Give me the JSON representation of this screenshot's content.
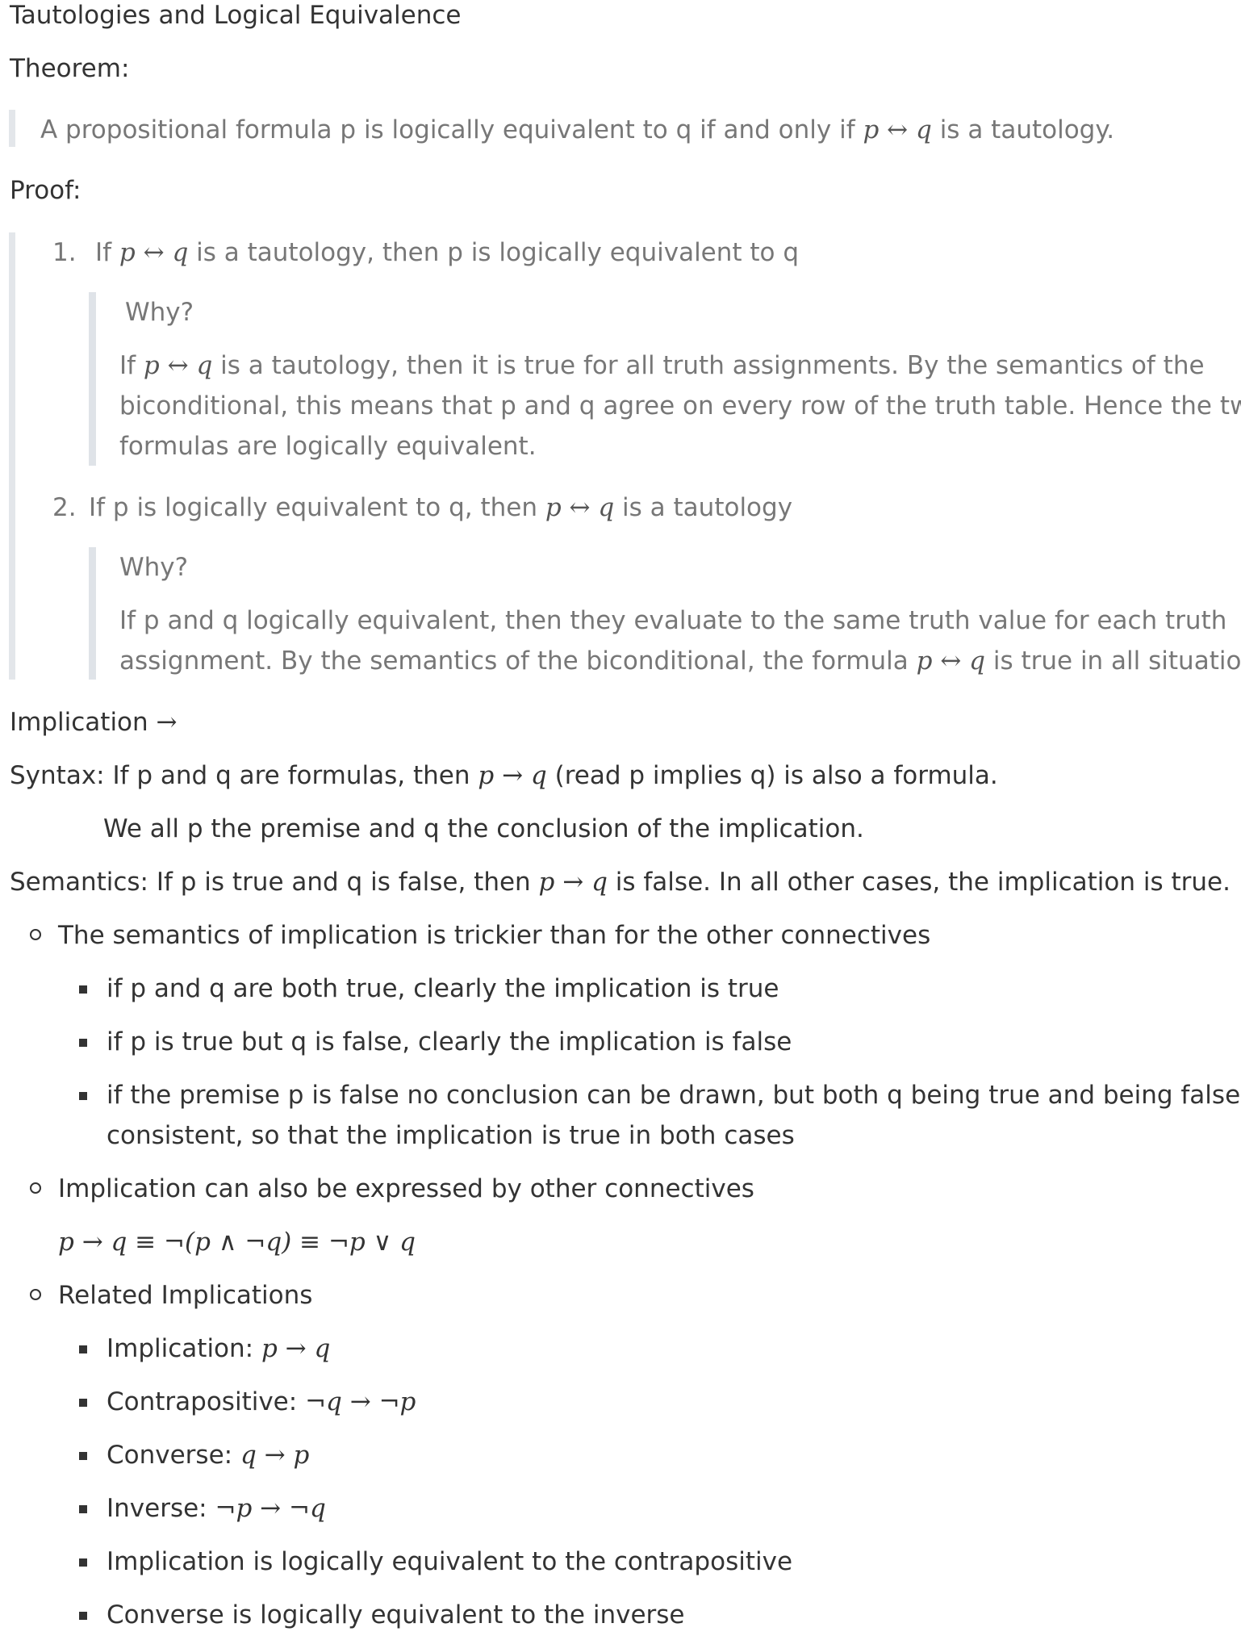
{
  "title": "Tautologies and Logical Equivalence",
  "theorem_label": "Theorem:",
  "theorem": {
    "pre": "A propositional formula p is logically equivalent to q if and only if ",
    "math": "p ↔ q",
    "post": " is a tautology."
  },
  "proof_label": "Proof:",
  "proof_items": [
    {
      "number": "1.",
      "pre": "If ",
      "math": "p ↔ q",
      "post": " is a tautology, then p is logically equivalent to q",
      "why": "Why?",
      "explanation_pre": "If ",
      "explanation_math": "p ↔ q",
      "explanation_line1_post": " is a tautology, then it is true for all truth assignments. By the semantics of the",
      "explanation_line2": "biconditional, this means that p and q agree on every row of the truth table. Hence the two",
      "explanation_line3": "formulas are logically equivalent."
    },
    {
      "number": "2.",
      "pre": "If p is logically equivalent to q, then ",
      "math": "p ↔ q",
      "post": " is a tautology",
      "why": "Why?",
      "explanation_line1": "If p and q logically equivalent, then they evaluate to the same truth value for each truth",
      "explanation_line2_pre": "assignment. By the semantics of the biconditional, the formula ",
      "explanation_math": "p ↔ q",
      "explanation_line2_post": " is true in all situations."
    }
  ],
  "implication_heading": {
    "text": "Implication ",
    "math": "→"
  },
  "syntax": {
    "pre": "Syntax: If p and q are formulas, then ",
    "math": "p → q",
    "post": " (read p implies q) is also a formula."
  },
  "premise_note": "We all p the premise and q the conclusion of the implication.",
  "semantics": {
    "pre": "Semantics: If p is true and q is false, then ",
    "math": "p → q",
    "post": " is false. In all other cases, the implication is true."
  },
  "bullets": {
    "trickier": "The semantics of implication is trickier than for the other connectives",
    "trickier_sub": [
      "if p and q are both true, clearly the implication is true",
      "if p is true but q is false, clearly the implication is false"
    ],
    "trickier_sub3_line1": "if the premise p is false no conclusion can be drawn, but both q being true and being false are",
    "trickier_sub3_line2": "consistent, so that the implication is true in both cases",
    "other_connectives": "Implication can also be expressed by other connectives",
    "equivalence_formula": "p → q ≡ ¬(p ∧ ¬q) ≡ ¬p ∨ q",
    "related": "Related Implications",
    "related_items": [
      {
        "label": "Implication: ",
        "math": "p → q"
      },
      {
        "label": "Contrapositive: ",
        "math": "¬q → ¬p"
      },
      {
        "label": "Converse: ",
        "math": "q → p"
      },
      {
        "label": "Inverse: ",
        "math": "¬p → ¬q"
      }
    ],
    "related_notes": [
      "Implication is logically equivalent to the contrapositive",
      "Converse is logically equivalent to the inverse"
    ]
  }
}
